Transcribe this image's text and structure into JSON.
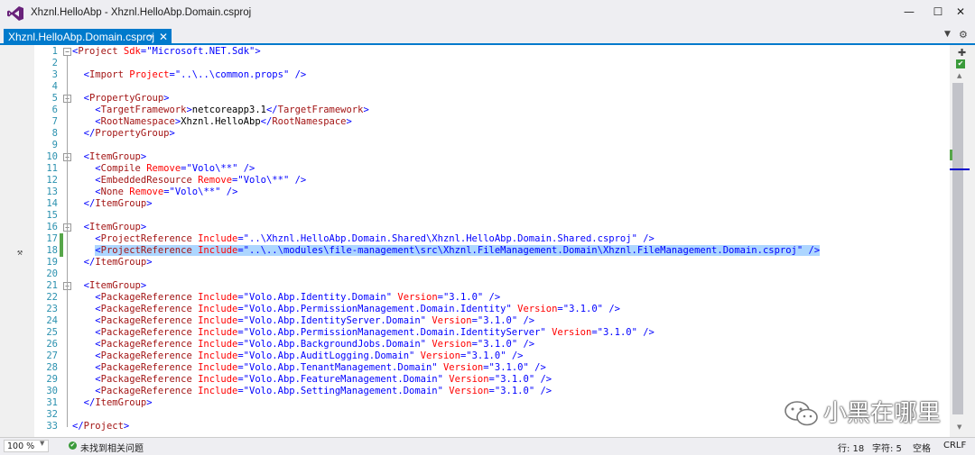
{
  "window": {
    "title": "Xhznl.HelloAbp - Xhznl.HelloAbp.Domain.csproj",
    "minimize": "—",
    "maximize": "☐",
    "close": "✕"
  },
  "tab": {
    "label": "Xhznl.HelloAbp.Domain.csproj",
    "pin": "⊸",
    "close": "✕",
    "overflow": "▼",
    "gear": "⚙"
  },
  "editor": {
    "lines": [
      {
        "n": "1",
        "tokens": [
          [
            "b",
            "<"
          ],
          [
            "e",
            "Project"
          ],
          [
            "a",
            " Sdk"
          ],
          [
            "b",
            "=\""
          ],
          [
            "v",
            "Microsoft.NET.Sdk"
          ],
          [
            "b",
            "\">"
          ]
        ]
      },
      {
        "n": "2",
        "tokens": []
      },
      {
        "n": "3",
        "tokens": [
          [
            "x",
            "  "
          ],
          [
            "b",
            "<"
          ],
          [
            "e",
            "Import"
          ],
          [
            "a",
            " Project"
          ],
          [
            "b",
            "=\""
          ],
          [
            "v",
            "..\\..\\common.props"
          ],
          [
            "b",
            "\" />"
          ]
        ]
      },
      {
        "n": "4",
        "tokens": []
      },
      {
        "n": "5",
        "tokens": [
          [
            "x",
            "  "
          ],
          [
            "b",
            "<"
          ],
          [
            "e",
            "PropertyGroup"
          ],
          [
            "b",
            ">"
          ]
        ]
      },
      {
        "n": "6",
        "tokens": [
          [
            "x",
            "    "
          ],
          [
            "b",
            "<"
          ],
          [
            "e",
            "TargetFramework"
          ],
          [
            "b",
            ">"
          ],
          [
            "x",
            "netcoreapp3.1"
          ],
          [
            "b",
            "</"
          ],
          [
            "e",
            "TargetFramework"
          ],
          [
            "b",
            ">"
          ]
        ]
      },
      {
        "n": "7",
        "tokens": [
          [
            "x",
            "    "
          ],
          [
            "b",
            "<"
          ],
          [
            "e",
            "RootNamespace"
          ],
          [
            "b",
            ">"
          ],
          [
            "x",
            "Xhznl.HelloAbp"
          ],
          [
            "b",
            "</"
          ],
          [
            "e",
            "RootNamespace"
          ],
          [
            "b",
            ">"
          ]
        ]
      },
      {
        "n": "8",
        "tokens": [
          [
            "x",
            "  "
          ],
          [
            "b",
            "</"
          ],
          [
            "e",
            "PropertyGroup"
          ],
          [
            "b",
            ">"
          ]
        ]
      },
      {
        "n": "9",
        "tokens": []
      },
      {
        "n": "10",
        "tokens": [
          [
            "x",
            "  "
          ],
          [
            "b",
            "<"
          ],
          [
            "e",
            "ItemGroup"
          ],
          [
            "b",
            ">"
          ]
        ]
      },
      {
        "n": "11",
        "tokens": [
          [
            "x",
            "    "
          ],
          [
            "b",
            "<"
          ],
          [
            "e",
            "Compile"
          ],
          [
            "a",
            " Remove"
          ],
          [
            "b",
            "=\""
          ],
          [
            "v",
            "Volo\\**"
          ],
          [
            "b",
            "\" />"
          ]
        ]
      },
      {
        "n": "12",
        "tokens": [
          [
            "x",
            "    "
          ],
          [
            "b",
            "<"
          ],
          [
            "e",
            "EmbeddedResource"
          ],
          [
            "a",
            " Remove"
          ],
          [
            "b",
            "=\""
          ],
          [
            "v",
            "Volo\\**"
          ],
          [
            "b",
            "\" />"
          ]
        ]
      },
      {
        "n": "13",
        "tokens": [
          [
            "x",
            "    "
          ],
          [
            "b",
            "<"
          ],
          [
            "e",
            "None"
          ],
          [
            "a",
            " Remove"
          ],
          [
            "b",
            "=\""
          ],
          [
            "v",
            "Volo\\**"
          ],
          [
            "b",
            "\" />"
          ]
        ]
      },
      {
        "n": "14",
        "tokens": [
          [
            "x",
            "  "
          ],
          [
            "b",
            "</"
          ],
          [
            "e",
            "ItemGroup"
          ],
          [
            "b",
            ">"
          ]
        ]
      },
      {
        "n": "15",
        "tokens": []
      },
      {
        "n": "16",
        "tokens": [
          [
            "x",
            "  "
          ],
          [
            "b",
            "<"
          ],
          [
            "e",
            "ItemGroup"
          ],
          [
            "b",
            ">"
          ]
        ]
      },
      {
        "n": "17",
        "tokens": [
          [
            "x",
            "    "
          ],
          [
            "b",
            "<"
          ],
          [
            "e",
            "ProjectReference"
          ],
          [
            "a",
            " Include"
          ],
          [
            "b",
            "=\""
          ],
          [
            "v",
            "..\\Xhznl.HelloAbp.Domain.Shared\\Xhznl.HelloAbp.Domain.Shared.csproj"
          ],
          [
            "b",
            "\" />"
          ]
        ]
      },
      {
        "n": "18",
        "tokens": [
          [
            "x",
            "    "
          ],
          [
            "b",
            "<"
          ],
          [
            "e",
            "ProjectReference"
          ],
          [
            "a",
            " Include"
          ],
          [
            "b",
            "=\""
          ],
          [
            "v",
            "..\\..\\modules\\file-management\\src\\Xhznl.FileManagement.Domain\\Xhznl.FileManagement.Domain.csproj"
          ],
          [
            "b",
            "\" />"
          ]
        ]
      },
      {
        "n": "19",
        "tokens": [
          [
            "x",
            "  "
          ],
          [
            "b",
            "</"
          ],
          [
            "e",
            "ItemGroup"
          ],
          [
            "b",
            ">"
          ]
        ]
      },
      {
        "n": "20",
        "tokens": []
      },
      {
        "n": "21",
        "tokens": [
          [
            "x",
            "  "
          ],
          [
            "b",
            "<"
          ],
          [
            "e",
            "ItemGroup"
          ],
          [
            "b",
            ">"
          ]
        ]
      },
      {
        "n": "22",
        "tokens": [
          [
            "x",
            "    "
          ],
          [
            "b",
            "<"
          ],
          [
            "e",
            "PackageReference"
          ],
          [
            "a",
            " Include"
          ],
          [
            "b",
            "=\""
          ],
          [
            "v",
            "Volo.Abp.Identity.Domain"
          ],
          [
            "b",
            "\""
          ],
          [
            "a",
            " Version"
          ],
          [
            "b",
            "=\""
          ],
          [
            "v",
            "3.1.0"
          ],
          [
            "b",
            "\" />"
          ]
        ]
      },
      {
        "n": "23",
        "tokens": [
          [
            "x",
            "    "
          ],
          [
            "b",
            "<"
          ],
          [
            "e",
            "PackageReference"
          ],
          [
            "a",
            " Include"
          ],
          [
            "b",
            "=\""
          ],
          [
            "v",
            "Volo.Abp.PermissionManagement.Domain.Identity"
          ],
          [
            "b",
            "\""
          ],
          [
            "a",
            " Version"
          ],
          [
            "b",
            "=\""
          ],
          [
            "v",
            "3.1.0"
          ],
          [
            "b",
            "\" />"
          ]
        ]
      },
      {
        "n": "24",
        "tokens": [
          [
            "x",
            "    "
          ],
          [
            "b",
            "<"
          ],
          [
            "e",
            "PackageReference"
          ],
          [
            "a",
            " Include"
          ],
          [
            "b",
            "=\""
          ],
          [
            "v",
            "Volo.Abp.IdentityServer.Domain"
          ],
          [
            "b",
            "\""
          ],
          [
            "a",
            " Version"
          ],
          [
            "b",
            "=\""
          ],
          [
            "v",
            "3.1.0"
          ],
          [
            "b",
            "\" />"
          ]
        ]
      },
      {
        "n": "25",
        "tokens": [
          [
            "x",
            "    "
          ],
          [
            "b",
            "<"
          ],
          [
            "e",
            "PackageReference"
          ],
          [
            "a",
            " Include"
          ],
          [
            "b",
            "=\""
          ],
          [
            "v",
            "Volo.Abp.PermissionManagement.Domain.IdentityServer"
          ],
          [
            "b",
            "\""
          ],
          [
            "a",
            " Version"
          ],
          [
            "b",
            "=\""
          ],
          [
            "v",
            "3.1.0"
          ],
          [
            "b",
            "\" />"
          ]
        ]
      },
      {
        "n": "26",
        "tokens": [
          [
            "x",
            "    "
          ],
          [
            "b",
            "<"
          ],
          [
            "e",
            "PackageReference"
          ],
          [
            "a",
            " Include"
          ],
          [
            "b",
            "=\""
          ],
          [
            "v",
            "Volo.Abp.BackgroundJobs.Domain"
          ],
          [
            "b",
            "\""
          ],
          [
            "a",
            " Version"
          ],
          [
            "b",
            "=\""
          ],
          [
            "v",
            "3.1.0"
          ],
          [
            "b",
            "\" />"
          ]
        ]
      },
      {
        "n": "27",
        "tokens": [
          [
            "x",
            "    "
          ],
          [
            "b",
            "<"
          ],
          [
            "e",
            "PackageReference"
          ],
          [
            "a",
            " Include"
          ],
          [
            "b",
            "=\""
          ],
          [
            "v",
            "Volo.Abp.AuditLogging.Domain"
          ],
          [
            "b",
            "\""
          ],
          [
            "a",
            " Version"
          ],
          [
            "b",
            "=\""
          ],
          [
            "v",
            "3.1.0"
          ],
          [
            "b",
            "\" />"
          ]
        ]
      },
      {
        "n": "28",
        "tokens": [
          [
            "x",
            "    "
          ],
          [
            "b",
            "<"
          ],
          [
            "e",
            "PackageReference"
          ],
          [
            "a",
            " Include"
          ],
          [
            "b",
            "=\""
          ],
          [
            "v",
            "Volo.Abp.TenantManagement.Domain"
          ],
          [
            "b",
            "\""
          ],
          [
            "a",
            " Version"
          ],
          [
            "b",
            "=\""
          ],
          [
            "v",
            "3.1.0"
          ],
          [
            "b",
            "\" />"
          ]
        ]
      },
      {
        "n": "29",
        "tokens": [
          [
            "x",
            "    "
          ],
          [
            "b",
            "<"
          ],
          [
            "e",
            "PackageReference"
          ],
          [
            "a",
            " Include"
          ],
          [
            "b",
            "=\""
          ],
          [
            "v",
            "Volo.Abp.FeatureManagement.Domain"
          ],
          [
            "b",
            "\""
          ],
          [
            "a",
            " Version"
          ],
          [
            "b",
            "=\""
          ],
          [
            "v",
            "3.1.0"
          ],
          [
            "b",
            "\" />"
          ]
        ]
      },
      {
        "n": "30",
        "tokens": [
          [
            "x",
            "    "
          ],
          [
            "b",
            "<"
          ],
          [
            "e",
            "PackageReference"
          ],
          [
            "a",
            " Include"
          ],
          [
            "b",
            "=\""
          ],
          [
            "v",
            "Volo.Abp.SettingManagement.Domain"
          ],
          [
            "b",
            "\""
          ],
          [
            "a",
            " Version"
          ],
          [
            "b",
            "=\""
          ],
          [
            "v",
            "3.1.0"
          ],
          [
            "b",
            "\" />"
          ]
        ]
      },
      {
        "n": "31",
        "tokens": [
          [
            "x",
            "  "
          ],
          [
            "b",
            "</"
          ],
          [
            "e",
            "ItemGroup"
          ],
          [
            "b",
            ">"
          ]
        ]
      },
      {
        "n": "32",
        "tokens": []
      },
      {
        "n": "33",
        "tokens": [
          [
            "b",
            "</"
          ],
          [
            "e",
            "Project"
          ],
          [
            "b",
            ">"
          ]
        ]
      }
    ],
    "collapsible_lines": [
      "1",
      "5",
      "10",
      "16",
      "21"
    ],
    "selected_line": "18",
    "changed_lines": [
      "17",
      "18"
    ]
  },
  "scrollbar": {
    "split": "✚",
    "check": "✔",
    "up": "▲",
    "down": "▼"
  },
  "status": {
    "zoom": "100 %",
    "zoom_arrow": "▼",
    "ok_icon": "✔",
    "message": "未找到相关问题",
    "line": "行: 18",
    "char": "字符: 5",
    "spacing": "空格",
    "eol": "CRLF"
  },
  "watermark": {
    "text": "小黑在哪里"
  },
  "colors": {
    "accent": "#007acc",
    "bracket": "#0000ff",
    "element": "#a31515",
    "attribute": "#ff0000",
    "line_number": "#2b91af",
    "selection": "#add6ff"
  }
}
